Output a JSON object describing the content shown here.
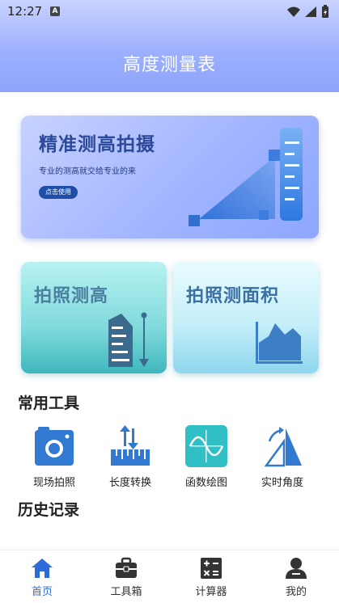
{
  "status_bar": {
    "time": "12:27",
    "notification_letter": "A"
  },
  "header": {
    "title": "高度测量表"
  },
  "banner": {
    "title": "精准测高拍摄",
    "subtitle": "专业的测高就交给专业的来",
    "button_label": "点击使用"
  },
  "cards": [
    {
      "title": "拍照测高"
    },
    {
      "title": "拍照测面积"
    }
  ],
  "sections": {
    "common_tools": "常用工具",
    "history": "历史记录"
  },
  "tools": [
    {
      "label": "现场拍照",
      "icon": "camera-icon"
    },
    {
      "label": "长度转换",
      "icon": "ruler-convert-icon"
    },
    {
      "label": "函数绘图",
      "icon": "function-graph-icon"
    },
    {
      "label": "实时角度",
      "icon": "angle-icon"
    }
  ],
  "nav": [
    {
      "label": "首页",
      "icon": "home-icon",
      "active": true
    },
    {
      "label": "工具箱",
      "icon": "toolbox-icon",
      "active": false
    },
    {
      "label": "计算器",
      "icon": "calculator-icon",
      "active": false
    },
    {
      "label": "我的",
      "icon": "user-icon",
      "active": false
    }
  ],
  "colors": {
    "accent": "#2f6bd8",
    "header": "#9db0ff",
    "banner_title": "#2d4a9a",
    "card_title": "#3a6fa4"
  }
}
